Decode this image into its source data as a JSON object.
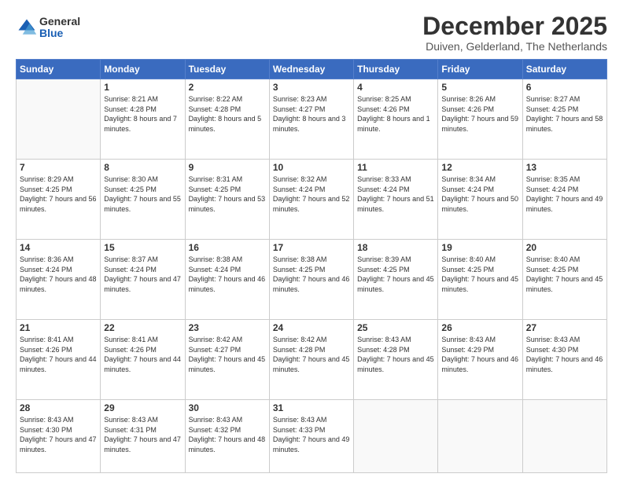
{
  "logo": {
    "general": "General",
    "blue": "Blue"
  },
  "header": {
    "month": "December 2025",
    "location": "Duiven, Gelderland, The Netherlands"
  },
  "weekdays": [
    "Sunday",
    "Monday",
    "Tuesday",
    "Wednesday",
    "Thursday",
    "Friday",
    "Saturday"
  ],
  "weeks": [
    [
      {
        "day": "",
        "sunrise": "",
        "sunset": "",
        "daylight": ""
      },
      {
        "day": "1",
        "sunrise": "Sunrise: 8:21 AM",
        "sunset": "Sunset: 4:28 PM",
        "daylight": "Daylight: 8 hours and 7 minutes."
      },
      {
        "day": "2",
        "sunrise": "Sunrise: 8:22 AM",
        "sunset": "Sunset: 4:28 PM",
        "daylight": "Daylight: 8 hours and 5 minutes."
      },
      {
        "day": "3",
        "sunrise": "Sunrise: 8:23 AM",
        "sunset": "Sunset: 4:27 PM",
        "daylight": "Daylight: 8 hours and 3 minutes."
      },
      {
        "day": "4",
        "sunrise": "Sunrise: 8:25 AM",
        "sunset": "Sunset: 4:26 PM",
        "daylight": "Daylight: 8 hours and 1 minute."
      },
      {
        "day": "5",
        "sunrise": "Sunrise: 8:26 AM",
        "sunset": "Sunset: 4:26 PM",
        "daylight": "Daylight: 7 hours and 59 minutes."
      },
      {
        "day": "6",
        "sunrise": "Sunrise: 8:27 AM",
        "sunset": "Sunset: 4:25 PM",
        "daylight": "Daylight: 7 hours and 58 minutes."
      }
    ],
    [
      {
        "day": "7",
        "sunrise": "Sunrise: 8:29 AM",
        "sunset": "Sunset: 4:25 PM",
        "daylight": "Daylight: 7 hours and 56 minutes."
      },
      {
        "day": "8",
        "sunrise": "Sunrise: 8:30 AM",
        "sunset": "Sunset: 4:25 PM",
        "daylight": "Daylight: 7 hours and 55 minutes."
      },
      {
        "day": "9",
        "sunrise": "Sunrise: 8:31 AM",
        "sunset": "Sunset: 4:25 PM",
        "daylight": "Daylight: 7 hours and 53 minutes."
      },
      {
        "day": "10",
        "sunrise": "Sunrise: 8:32 AM",
        "sunset": "Sunset: 4:24 PM",
        "daylight": "Daylight: 7 hours and 52 minutes."
      },
      {
        "day": "11",
        "sunrise": "Sunrise: 8:33 AM",
        "sunset": "Sunset: 4:24 PM",
        "daylight": "Daylight: 7 hours and 51 minutes."
      },
      {
        "day": "12",
        "sunrise": "Sunrise: 8:34 AM",
        "sunset": "Sunset: 4:24 PM",
        "daylight": "Daylight: 7 hours and 50 minutes."
      },
      {
        "day": "13",
        "sunrise": "Sunrise: 8:35 AM",
        "sunset": "Sunset: 4:24 PM",
        "daylight": "Daylight: 7 hours and 49 minutes."
      }
    ],
    [
      {
        "day": "14",
        "sunrise": "Sunrise: 8:36 AM",
        "sunset": "Sunset: 4:24 PM",
        "daylight": "Daylight: 7 hours and 48 minutes."
      },
      {
        "day": "15",
        "sunrise": "Sunrise: 8:37 AM",
        "sunset": "Sunset: 4:24 PM",
        "daylight": "Daylight: 7 hours and 47 minutes."
      },
      {
        "day": "16",
        "sunrise": "Sunrise: 8:38 AM",
        "sunset": "Sunset: 4:24 PM",
        "daylight": "Daylight: 7 hours and 46 minutes."
      },
      {
        "day": "17",
        "sunrise": "Sunrise: 8:38 AM",
        "sunset": "Sunset: 4:25 PM",
        "daylight": "Daylight: 7 hours and 46 minutes."
      },
      {
        "day": "18",
        "sunrise": "Sunrise: 8:39 AM",
        "sunset": "Sunset: 4:25 PM",
        "daylight": "Daylight: 7 hours and 45 minutes."
      },
      {
        "day": "19",
        "sunrise": "Sunrise: 8:40 AM",
        "sunset": "Sunset: 4:25 PM",
        "daylight": "Daylight: 7 hours and 45 minutes."
      },
      {
        "day": "20",
        "sunrise": "Sunrise: 8:40 AM",
        "sunset": "Sunset: 4:25 PM",
        "daylight": "Daylight: 7 hours and 45 minutes."
      }
    ],
    [
      {
        "day": "21",
        "sunrise": "Sunrise: 8:41 AM",
        "sunset": "Sunset: 4:26 PM",
        "daylight": "Daylight: 7 hours and 44 minutes."
      },
      {
        "day": "22",
        "sunrise": "Sunrise: 8:41 AM",
        "sunset": "Sunset: 4:26 PM",
        "daylight": "Daylight: 7 hours and 44 minutes."
      },
      {
        "day": "23",
        "sunrise": "Sunrise: 8:42 AM",
        "sunset": "Sunset: 4:27 PM",
        "daylight": "Daylight: 7 hours and 45 minutes."
      },
      {
        "day": "24",
        "sunrise": "Sunrise: 8:42 AM",
        "sunset": "Sunset: 4:28 PM",
        "daylight": "Daylight: 7 hours and 45 minutes."
      },
      {
        "day": "25",
        "sunrise": "Sunrise: 8:43 AM",
        "sunset": "Sunset: 4:28 PM",
        "daylight": "Daylight: 7 hours and 45 minutes."
      },
      {
        "day": "26",
        "sunrise": "Sunrise: 8:43 AM",
        "sunset": "Sunset: 4:29 PM",
        "daylight": "Daylight: 7 hours and 46 minutes."
      },
      {
        "day": "27",
        "sunrise": "Sunrise: 8:43 AM",
        "sunset": "Sunset: 4:30 PM",
        "daylight": "Daylight: 7 hours and 46 minutes."
      }
    ],
    [
      {
        "day": "28",
        "sunrise": "Sunrise: 8:43 AM",
        "sunset": "Sunset: 4:30 PM",
        "daylight": "Daylight: 7 hours and 47 minutes."
      },
      {
        "day": "29",
        "sunrise": "Sunrise: 8:43 AM",
        "sunset": "Sunset: 4:31 PM",
        "daylight": "Daylight: 7 hours and 47 minutes."
      },
      {
        "day": "30",
        "sunrise": "Sunrise: 8:43 AM",
        "sunset": "Sunset: 4:32 PM",
        "daylight": "Daylight: 7 hours and 48 minutes."
      },
      {
        "day": "31",
        "sunrise": "Sunrise: 8:43 AM",
        "sunset": "Sunset: 4:33 PM",
        "daylight": "Daylight: 7 hours and 49 minutes."
      },
      {
        "day": "",
        "sunrise": "",
        "sunset": "",
        "daylight": ""
      },
      {
        "day": "",
        "sunrise": "",
        "sunset": "",
        "daylight": ""
      },
      {
        "day": "",
        "sunrise": "",
        "sunset": "",
        "daylight": ""
      }
    ]
  ]
}
